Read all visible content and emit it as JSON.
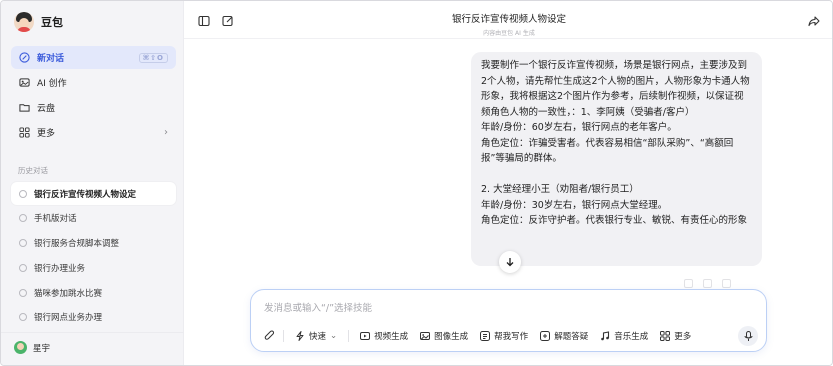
{
  "sidebar": {
    "brand": "豆包",
    "nav": [
      {
        "label": "新对话",
        "icon": "new-chat-icon",
        "shortcut": "⌘⇧O"
      },
      {
        "label": "AI 创作",
        "icon": "image-icon"
      },
      {
        "label": "云盘",
        "icon": "folder-icon"
      },
      {
        "label": "更多",
        "icon": "grid-icon"
      }
    ],
    "history_label": "历史对话",
    "history": [
      "银行反诈宣传视频人物设定",
      "手机版对话",
      "银行服务合规脚本调整",
      "银行办理业务",
      "猫咪参加跳水比赛",
      "银行网点业务办理"
    ],
    "user_name": "星宇"
  },
  "header": {
    "title": "银行反诈宣传视频人物设定",
    "subtitle": "内容由豆包 AI 生成"
  },
  "message": {
    "text": "我要制作一个银行反诈宣传视频，场景是银行网点，主要涉及到2个人物，请先帮忙生成这2个人物的图片，人物形象为卡通人物形象，我将根据这2个图片作为参考，后续制作视频，以保证视频角色人物的一致性，：1、李阿姨（受骗者/客户）\n年龄/身份：60岁左右，银行网点的老年客户。\n角色定位：诈骗受害者。代表容易相信“部队采购”、“高额回报”等骗局的群体。\n\n2. 大堂经理小王（劝阻者/银行员工）\n年龄/身份：30岁左右，银行网点大堂经理。\n角色定位：反诈守护者。代表银行专业、敏锐、有责任心的形象"
  },
  "composer": {
    "placeholder": "发消息或输入“/”选择技能",
    "tools": [
      {
        "label": "快速",
        "icon": "lightning-icon",
        "dropdown": true
      },
      {
        "label": "视频生成",
        "icon": "video-icon"
      },
      {
        "label": "图像生成",
        "icon": "image-gen-icon"
      },
      {
        "label": "帮我写作",
        "icon": "write-icon"
      },
      {
        "label": "解题答疑",
        "icon": "solve-icon"
      },
      {
        "label": "音乐生成",
        "icon": "music-icon"
      },
      {
        "label": "更多",
        "icon": "more-grid-icon"
      }
    ]
  },
  "colors": {
    "accent": "#3b5bdb",
    "active_bg": "#e3e8fb",
    "sidebar_bg": "#f4f4f7",
    "bubble_bg": "#f1f1f4",
    "composer_border": "#bcd0f5"
  }
}
